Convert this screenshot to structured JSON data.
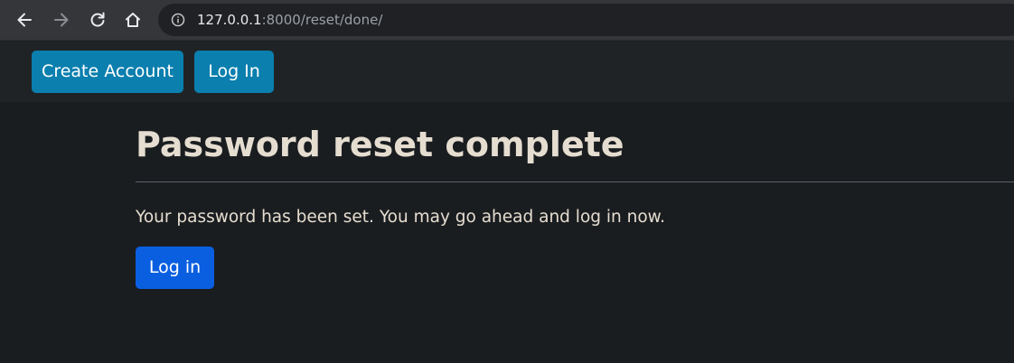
{
  "browser": {
    "url_host": "127.0.0.1",
    "url_path": ":8000/reset/done/",
    "icons": [
      "back-arrow-icon",
      "forward-arrow-icon",
      "reload-icon",
      "home-icon",
      "site-info-icon"
    ]
  },
  "navbar": {
    "create_account_label": "Create Account",
    "log_in_label": "Log In"
  },
  "main": {
    "title": "Password reset complete",
    "message": "Your password has been set. You may go ahead and log in now.",
    "login_button_label": "Log in"
  },
  "colors": {
    "page_bg": "#1a1d20",
    "navbar_bg": "#202326",
    "nav_button": "#0b7fae",
    "primary_button": "#0a5fe0",
    "text": "#e6ddd0"
  }
}
